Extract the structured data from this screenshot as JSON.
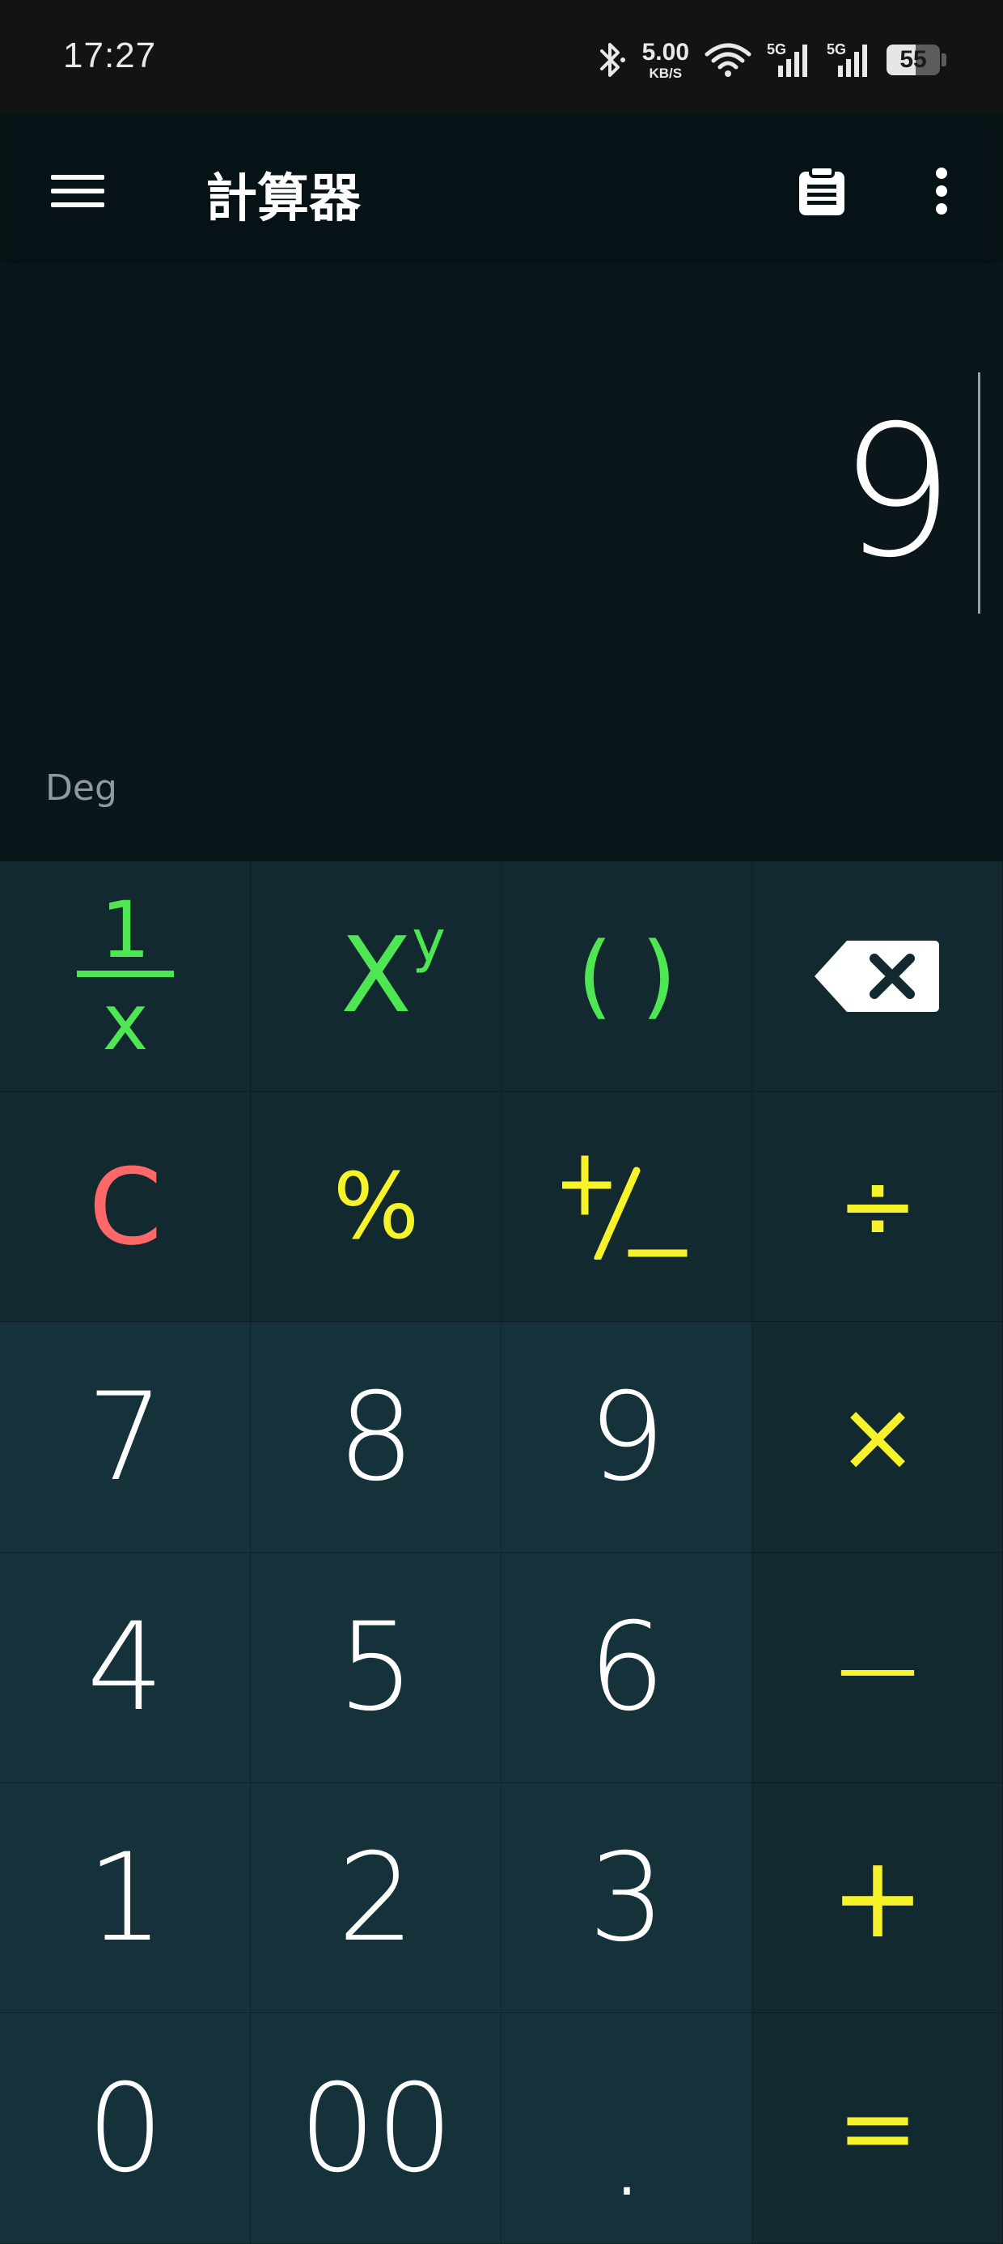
{
  "status_bar": {
    "time": "17:27",
    "net_speed_value": "5.00",
    "net_speed_unit": "KB/S",
    "signal_label_1": "5G",
    "signal_label_2": "5G",
    "battery_level": "55",
    "battery_fraction": 0.55,
    "icons": [
      "bluetooth-icon",
      "wifi-icon",
      "signal-5g-icon",
      "signal-5g-icon",
      "battery-icon"
    ]
  },
  "app_bar": {
    "title": "計算器",
    "icons": [
      "menu-icon",
      "clipboard-icon",
      "more-vert-icon"
    ]
  },
  "display": {
    "value": "9",
    "angle_mode": "Deg"
  },
  "keypad": {
    "row1": {
      "reciprocal_top": "1",
      "reciprocal_bottom": "x",
      "power_base": "X",
      "power_exp": "y",
      "parentheses": "( )",
      "backspace_icon": "backspace-icon"
    },
    "row2": {
      "clear": "C",
      "percent": "%",
      "plus_minus_icon": "plus-minus-icon",
      "divide": "÷"
    },
    "row3": {
      "seven": "7",
      "eight": "8",
      "nine": "9",
      "multiply": "×"
    },
    "row4": {
      "four": "4",
      "five": "5",
      "six": "6",
      "minus": "—"
    },
    "row5": {
      "one": "1",
      "two": "2",
      "three": "3",
      "plus": "+"
    },
    "row6": {
      "zero": "0",
      "double_zero": "00",
      "decimal": ".",
      "equals": "="
    }
  },
  "colors": {
    "function_green": "#4fe653",
    "operator_yellow": "#f6f32a",
    "clear_red": "#ff6868",
    "background": "#091417",
    "key_number_bg": "#15313a",
    "key_function_bg": "#12292f"
  }
}
